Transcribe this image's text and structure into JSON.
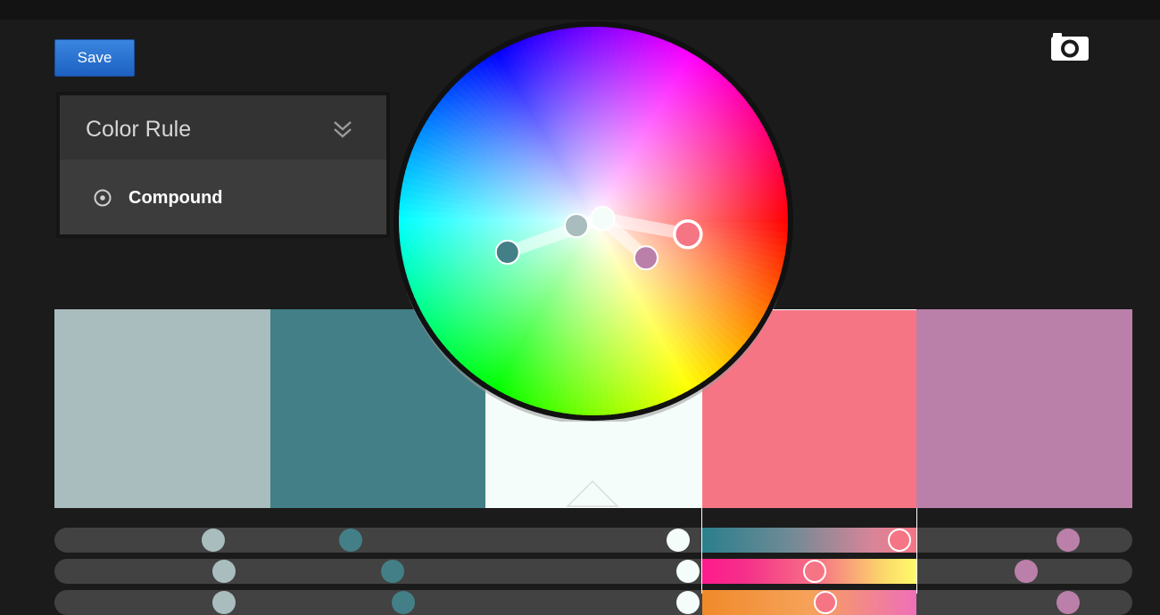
{
  "toolbar": {
    "save_label": "Save",
    "camera_icon": "camera-icon"
  },
  "color_rule": {
    "title": "Color Rule",
    "expand_icon": "double-chevron-down-icon",
    "selected_rule": "Compound",
    "radio_icon": "radio-selected-icon"
  },
  "colors": {
    "panel_bg": "#1b1b1b",
    "save_button": "#2a72d4",
    "swatches": [
      "#a9bcbe",
      "#437f86",
      "#f4fdf9",
      "#f67585",
      "#bb80a9"
    ],
    "selected_swatch_index": 3,
    "base_swatch_index": 2
  },
  "wheel": {
    "handles": [
      {
        "name": "base",
        "color": "#f4fdf9",
        "hue_deg": 15,
        "radius": 0.05,
        "active": false
      },
      {
        "name": "light-gray",
        "color": "#a9bcbe",
        "hue_deg": 195,
        "radius": 0.09,
        "active": false
      },
      {
        "name": "teal",
        "color": "#437f86",
        "hue_deg": 200,
        "radius": 0.47,
        "active": false
      },
      {
        "name": "mauve",
        "color": "#bb80a9",
        "hue_deg": 325,
        "radius": 0.33,
        "active": false
      },
      {
        "name": "pink",
        "color": "#f67585",
        "hue_deg": 352,
        "radius": 0.49,
        "active": true
      }
    ]
  },
  "sliders": [
    {
      "name": "hue-slider",
      "segment_gradient": "linear-gradient(90deg,#2a7f8c,#6e8a95 40%,#d88598 80%,#f67585)",
      "values": [
        0.14,
        0.27,
        0.58,
        0.79,
        0.95
      ]
    },
    {
      "name": "saturation-slider",
      "segment_gradient": "linear-gradient(90deg,#ff1a8c,#f5308a 20%,#f67585 55%,#fbd96a 85%,#fffa6a)",
      "values": [
        0.15,
        0.31,
        0.59,
        0.71,
        0.91
      ]
    },
    {
      "name": "brightness-slider",
      "segment_gradient": "linear-gradient(90deg,#f08a2a,#f6a25a 50%,#ef6fb8)",
      "values": [
        0.15,
        0.32,
        0.59,
        0.72,
        0.95
      ]
    }
  ]
}
